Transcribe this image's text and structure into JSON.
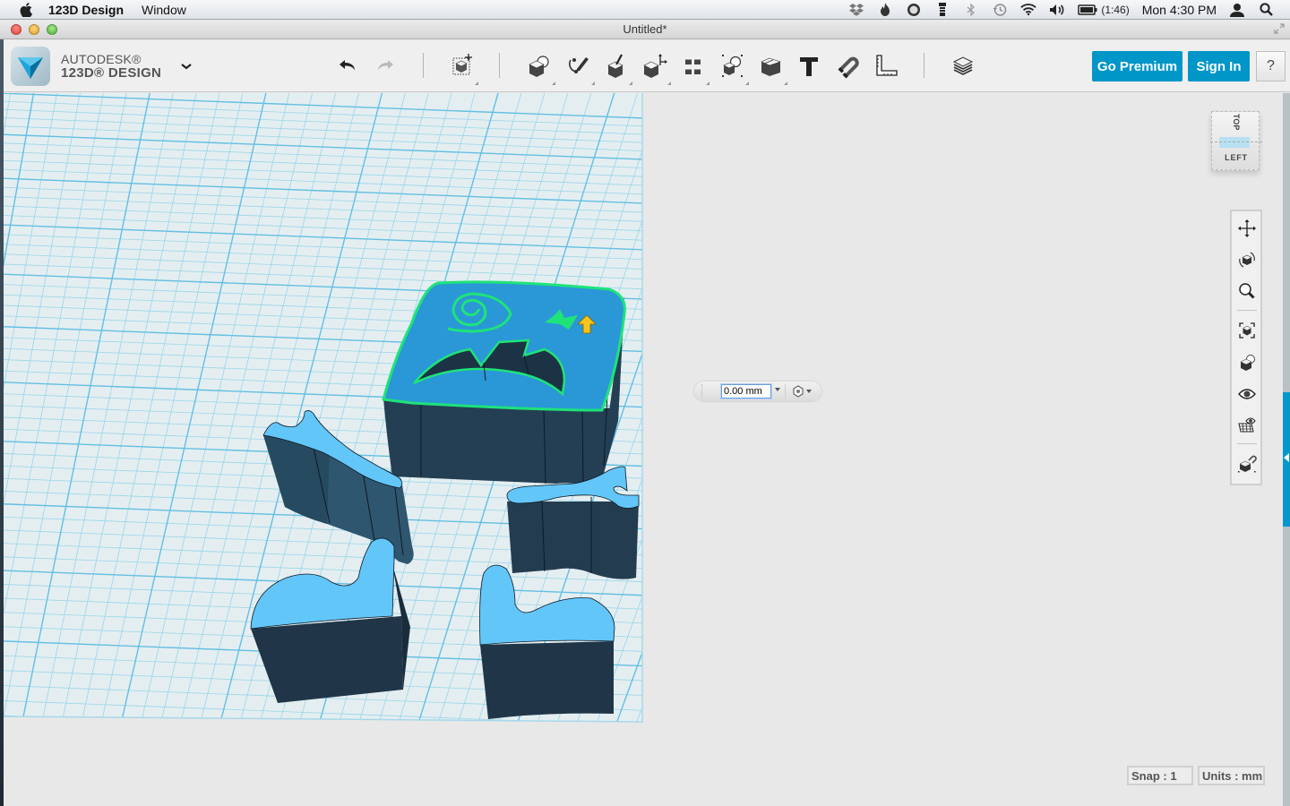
{
  "menubar": {
    "app_name": "123D Design",
    "menus": [
      "Window"
    ],
    "status_icons": [
      "dropbox-icon",
      "flame-icon",
      "gauge-icon",
      "flashlight-icon",
      "bluetooth-icon",
      "time-machine-icon",
      "wifi-icon",
      "volume-icon",
      "battery-icon"
    ],
    "battery_text": "(1:46)",
    "clock": "Mon 4:30 PM"
  },
  "window": {
    "title": "Untitled*"
  },
  "brand": {
    "line1": "AUTODESK®",
    "line2": "123D® DESIGN"
  },
  "toolbar": {
    "tools": [
      {
        "name": "undo",
        "label": "Undo"
      },
      {
        "name": "redo",
        "label": "Redo",
        "disabled": true
      },
      {
        "name": "transform",
        "label": "Transform"
      },
      {
        "name": "primitives",
        "label": "Primitives"
      },
      {
        "name": "sketch",
        "label": "Sketch"
      },
      {
        "name": "construct",
        "label": "Construct"
      },
      {
        "name": "modify",
        "label": "Modify"
      },
      {
        "name": "pattern",
        "label": "Pattern"
      },
      {
        "name": "grouping",
        "label": "Grouping"
      },
      {
        "name": "combine",
        "label": "Combine"
      },
      {
        "name": "text",
        "label": "Text"
      },
      {
        "name": "snap",
        "label": "Snap"
      },
      {
        "name": "measure",
        "label": "Measure"
      },
      {
        "name": "material",
        "label": "Material"
      }
    ],
    "go_premium": "Go Premium",
    "sign_in": "Sign In",
    "help": "?"
  },
  "viewcube": {
    "top_label": "TOP",
    "face_label": "LEFT"
  },
  "navbar": {
    "items": [
      "pan",
      "orbit",
      "zoom",
      "fit",
      "views",
      "visibility",
      "materials-and-outlines",
      "snap-to"
    ]
  },
  "value_input": {
    "value": "0.00 mm"
  },
  "status": {
    "snap": "Snap : 1",
    "units": "Units : mm"
  },
  "colors": {
    "accent": "#0196c8",
    "grid_bg": "#e4eef1",
    "grid_line": "#7fcbe6",
    "solid_top": "#63c6f9",
    "solid_side": "#233c50",
    "selected_top": "#2b97d6",
    "selection_outline": "#1ee37a"
  }
}
